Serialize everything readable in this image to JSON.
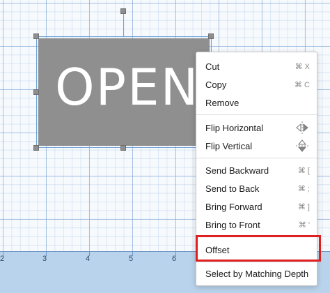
{
  "canvas": {
    "sign_text": "OPEN"
  },
  "ruler": {
    "labels": [
      "2",
      "3",
      "4",
      "5",
      "6"
    ]
  },
  "context_menu": {
    "cut": {
      "label": "Cut",
      "shortcut": "⌘ X"
    },
    "copy": {
      "label": "Copy",
      "shortcut": "⌘ C"
    },
    "remove": {
      "label": "Remove"
    },
    "flip_horizontal": {
      "label": "Flip Horizontal",
      "icon": "flip-horizontal-icon"
    },
    "flip_vertical": {
      "label": "Flip Vertical",
      "icon": "flip-vertical-icon"
    },
    "send_backward": {
      "label": "Send Backward",
      "shortcut": "⌘ ["
    },
    "send_to_back": {
      "label": "Send to Back",
      "shortcut": "⌘ ;"
    },
    "bring_forward": {
      "label": "Bring Forward",
      "shortcut": "⌘ ]"
    },
    "bring_to_front": {
      "label": "Bring to Front",
      "shortcut": "⌘ '"
    },
    "offset": {
      "label": "Offset"
    },
    "select_by_matching_depth": {
      "label": "Select by Matching Depth"
    }
  },
  "colors": {
    "sign_fill": "#8f8f8f",
    "highlight": "#e02020",
    "ruler_bg": "#b9d3ec"
  }
}
